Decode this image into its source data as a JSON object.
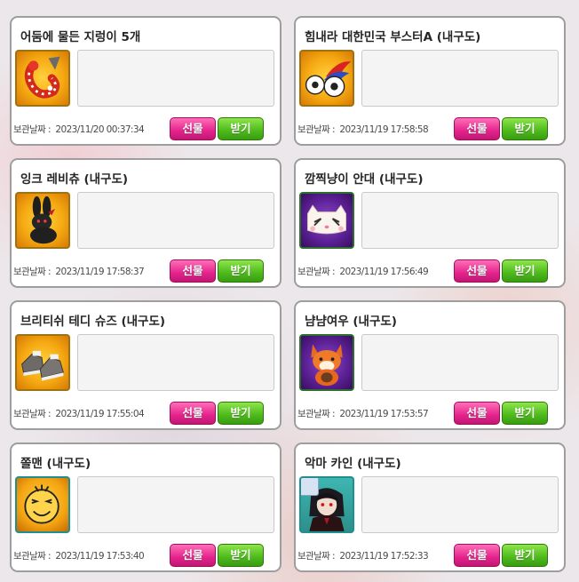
{
  "labels": {
    "saved_date": "보관날짜 :",
    "gift": "선물",
    "receive": "받기"
  },
  "items": [
    {
      "title": "어둠에 물든 지렁이 5개",
      "date": "2023/11/20 00:37:34",
      "icon": "worm-icon"
    },
    {
      "title": "힘내라 대한민국 부스터A (내구도)",
      "date": "2023/11/19 17:58:58",
      "icon": "soccer-ball-booster-icon"
    },
    {
      "title": "잉크 레비츄 (내구도)",
      "date": "2023/11/19 17:58:37",
      "icon": "black-rabbit-icon"
    },
    {
      "title": "깜찍냥이 안대 (내구도)",
      "date": "2023/11/19 17:56:49",
      "icon": "cat-eye-mask-icon"
    },
    {
      "title": "브리티쉬 테디 슈즈 (내구도)",
      "date": "2023/11/19 17:55:04",
      "icon": "shoes-icon"
    },
    {
      "title": "냠냠여우 (내구도)",
      "date": "2023/11/19 17:53:57",
      "icon": "fox-icon"
    },
    {
      "title": "쫄맨 (내구도)",
      "date": "2023/11/19 17:53:40",
      "icon": "smiley-face-icon"
    },
    {
      "title": "악마 카인 (내구도)",
      "date": "2023/11/19 17:52:33",
      "icon": "devil-character-icon"
    }
  ]
}
